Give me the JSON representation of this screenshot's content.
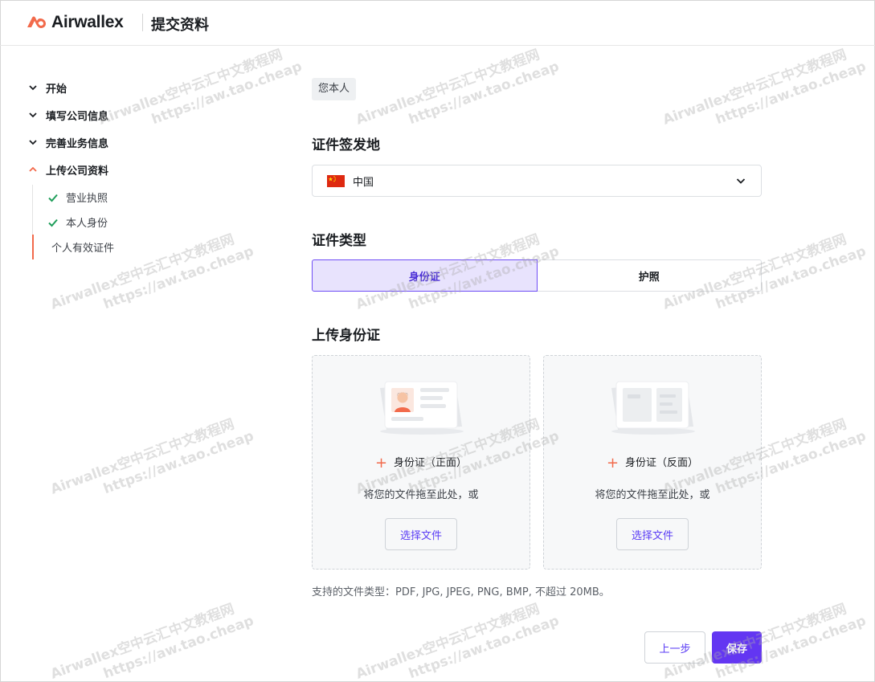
{
  "brand": {
    "name": "Airwallex",
    "accent": "#f26a4b"
  },
  "header": {
    "title": "提交资料"
  },
  "sidebar": {
    "items": [
      {
        "label": "开始",
        "state": "collapsed"
      },
      {
        "label": "填写公司信息",
        "state": "collapsed"
      },
      {
        "label": "完善业务信息",
        "state": "collapsed"
      },
      {
        "label": "上传公司资料",
        "state": "expanded"
      }
    ],
    "substeps": [
      {
        "label": "营业执照",
        "done": true
      },
      {
        "label": "本人身份",
        "done": true
      },
      {
        "label": "个人有效证件",
        "done": false,
        "current": true
      }
    ]
  },
  "main": {
    "person_chip": "您本人",
    "issuing_place": {
      "title": "证件签发地",
      "value": "中国",
      "icon": "china-flag-icon"
    },
    "id_type": {
      "title": "证件类型",
      "options": [
        "身份证",
        "护照"
      ],
      "selected": "身份证"
    },
    "upload": {
      "title": "上传身份证",
      "front": {
        "label": "身份证（正面）",
        "hint": "将您的文件拖至此处，或",
        "button": "选择文件"
      },
      "back": {
        "label": "身份证（反面）",
        "hint": "将您的文件拖至此处，或",
        "button": "选择文件"
      },
      "support_text": "支持的文件类型：PDF, JPG, JPEG, PNG, BMP, 不超过 20MB。"
    }
  },
  "footer": {
    "prev_label": "上一步",
    "save_label": "保存",
    "primary_color": "#6336f2"
  },
  "watermark": {
    "line1": "Airwallex空中云汇中文教程网",
    "line2": "https://aw.tao.cheap"
  }
}
